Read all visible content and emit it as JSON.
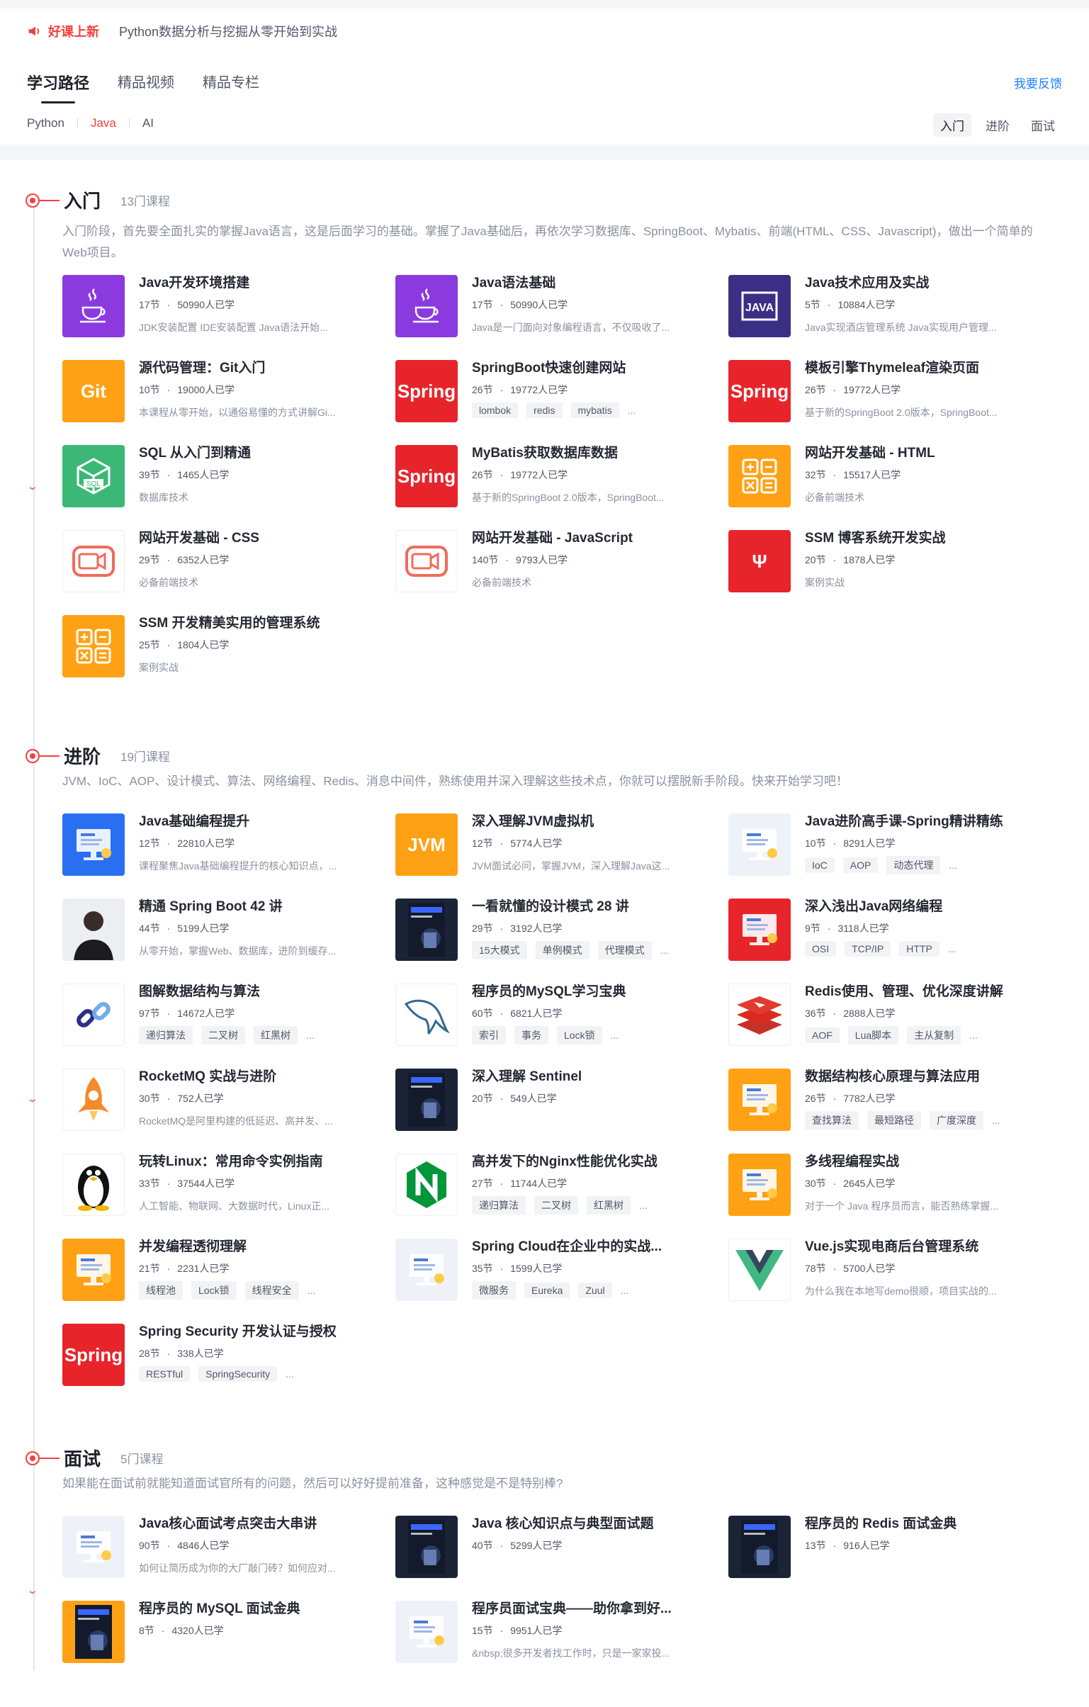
{
  "banner": {
    "tag": "好课上新",
    "title": "Python数据分析与挖掘从零开始到实战"
  },
  "nav": {
    "tabs": [
      "学习路径",
      "精品视频",
      "精品专栏"
    ],
    "feedback": "我要反馈",
    "subtabs": [
      "Python",
      "Java",
      "AI"
    ],
    "levels": [
      "入门",
      "进阶",
      "面试"
    ]
  },
  "sections": [
    {
      "title": "入门",
      "count": "13门课程",
      "desc": "入门阶段，首先要全面扎实的掌握Java语言，这是后面学习的基础。掌握了Java基础后，再依次学习数据库、SpringBoot、Mybatis、前端(HTML、CSS、Javascript)，做出一个简单的Web项目。",
      "courses": [
        {
          "title": "Java开发环境搭建",
          "lessons": "17节",
          "learners": "50990人已学",
          "desc": "JDK安装配置 IDE安装配置 Java语法开始...",
          "tags": [],
          "thumb": "java-cup",
          "bg": "t-purple"
        },
        {
          "title": "Java语法基础",
          "lessons": "17节",
          "learners": "50990人已学",
          "desc": "Java是一门面向对象编程语言，不仅吸收了...",
          "tags": [],
          "thumb": "java-cup",
          "bg": "t-purple"
        },
        {
          "title": "Java技术应用及实战",
          "lessons": "5节",
          "learners": "10884人已学",
          "desc": "Java实现酒店管理系统 Java实现用户管理...",
          "tags": [],
          "thumb": "java-logo",
          "bg": "t-navy"
        },
        {
          "title": "源代码管理：Git入门",
          "lessons": "10节",
          "learners": "19000人已学",
          "desc": "本课程从零开始，以通俗易懂的方式讲解Gi...",
          "tags": [],
          "thumb": "Git",
          "bg": "t-orange"
        },
        {
          "title": "SpringBoot快速创建网站",
          "lessons": "26节",
          "learners": "19772人已学",
          "desc": "",
          "tags": [
            "lombok",
            "redis",
            "mybatis"
          ],
          "thumb": "Spring",
          "bg": "t-red"
        },
        {
          "title": "模板引擎Thymeleaf渲染页面",
          "lessons": "26节",
          "learners": "19772人已学",
          "desc": "基于新的SpringBoot 2.0版本，SpringBoot...",
          "tags": [],
          "thumb": "Spring",
          "bg": "t-red"
        },
        {
          "title": "SQL 从入门到精通",
          "lessons": "39节",
          "learners": "1465人已学",
          "desc": "数据库技术",
          "tags": [],
          "thumb": "sql-box",
          "bg": "t-green"
        },
        {
          "title": "MyBatis获取数据库数据",
          "lessons": "26节",
          "learners": "19772人已学",
          "desc": "基于新的SpringBoot 2.0版本，SpringBoot...",
          "tags": [],
          "thumb": "Spring",
          "bg": "t-red"
        },
        {
          "title": "网站开发基础 - HTML",
          "lessons": "32节",
          "learners": "15517人已学",
          "desc": "必备前端技术",
          "tags": [],
          "thumb": "calc",
          "bg": "t-orange"
        },
        {
          "title": "网站开发基础 - CSS",
          "lessons": "29节",
          "learners": "6352人已学",
          "desc": "必备前端技术",
          "tags": [],
          "thumb": "video",
          "bg": "t-white"
        },
        {
          "title": "网站开发基础 - JavaScript",
          "lessons": "140节",
          "learners": "9793人已学",
          "desc": "必备前端技术",
          "tags": [],
          "thumb": "video",
          "bg": "t-white"
        },
        {
          "title": "SSM 博客系统开发实战",
          "lessons": "20节",
          "learners": "1878人已学",
          "desc": "案例实战",
          "tags": [],
          "thumb": "Ψ",
          "bg": "t-red"
        },
        {
          "title": "SSM 开发精美实用的管理系统",
          "lessons": "25节",
          "learners": "1804人已学",
          "desc": "案例实战",
          "tags": [],
          "thumb": "calc",
          "bg": "t-orange"
        }
      ]
    },
    {
      "title": "进阶",
      "count": "19门课程",
      "desc": "JVM、IoC、AOP、设计模式、算法、网络编程、Redis、消息中间件，熟练使用并深入理解这些技术点，你就可以摆脱新手阶段。快来开始学习吧！",
      "courses": [
        {
          "title": "Java基础编程提升",
          "lessons": "12节",
          "learners": "22810人已学",
          "desc": "课程聚焦Java基础编程提升的核心知识点，...",
          "tags": [],
          "thumb": "screen",
          "bg": "t-blue"
        },
        {
          "title": "深入理解JVM虚拟机",
          "lessons": "12节",
          "learners": "5774人已学",
          "desc": "JVM面试必问，掌握JVM，深入理解Java这...",
          "tags": [],
          "thumb": "JVM",
          "bg": "t-orange"
        },
        {
          "title": "Java进阶高手课-Spring精讲精练",
          "lessons": "10节",
          "learners": "8291人已学",
          "desc": "",
          "tags": [
            "IoC",
            "AOP",
            "动态代理"
          ],
          "thumb": "screen",
          "bg": "t-light"
        },
        {
          "title": "精通 Spring Boot 42 讲",
          "lessons": "44节",
          "learners": "5199人已学",
          "desc": "从零开始，掌握Web、数据库，进阶到缓存...",
          "tags": [],
          "thumb": "person",
          "bg": "t-white"
        },
        {
          "title": "一看就懂的设计模式 28 讲",
          "lessons": "29节",
          "learners": "3192人已学",
          "desc": "",
          "tags": [
            "15大模式",
            "单例模式",
            "代理模式"
          ],
          "thumb": "book",
          "bg": "t-dark"
        },
        {
          "title": "深入浅出Java网络编程",
          "lessons": "9节",
          "learners": "3118人已学",
          "desc": "",
          "tags": [
            "OSI",
            "TCP/IP",
            "HTTP"
          ],
          "thumb": "screen",
          "bg": "t-red"
        },
        {
          "title": "图解数据结构与算法",
          "lessons": "97节",
          "learners": "14672人已学",
          "desc": "",
          "tags": [
            "递归算法",
            "二叉树",
            "红黑树"
          ],
          "thumb": "link",
          "bg": "t-white"
        },
        {
          "title": "程序员的MySQL学习宝典",
          "lessons": "60节",
          "learners": "6821人已学",
          "desc": "",
          "tags": [
            "索引",
            "事务",
            "Lock锁"
          ],
          "thumb": "dolphin",
          "bg": "t-white"
        },
        {
          "title": "Redis使用、管理、优化深度讲解",
          "lessons": "36节",
          "learners": "2888人已学",
          "desc": "",
          "tags": [
            "AOF",
            "Lua脚本",
            "主从复制"
          ],
          "thumb": "redis",
          "bg": "t-white"
        },
        {
          "title": "RocketMQ 实战与进阶",
          "lessons": "30节",
          "learners": "752人已学",
          "desc": "RocketMQ是阿里构建的低延迟、高并发、...",
          "tags": [],
          "thumb": "rocket",
          "bg": "t-white"
        },
        {
          "title": "深入理解 Sentinel",
          "lessons": "20节",
          "learners": "549人已学",
          "desc": "",
          "tags": [],
          "thumb": "book",
          "bg": "t-dark"
        },
        {
          "title": "数据结构核心原理与算法应用",
          "lessons": "26节",
          "learners": "7782人已学",
          "desc": "",
          "tags": [
            "查找算法",
            "最短路径",
            "广度深度"
          ],
          "thumb": "screen",
          "bg": "t-orange"
        },
        {
          "title": "玩转Linux：常用命令实例指南",
          "lessons": "33节",
          "learners": "37544人已学",
          "desc": "人工智能、物联网、大数据时代，Linux正...",
          "tags": [],
          "thumb": "penguin",
          "bg": "t-white"
        },
        {
          "title": "高并发下的Nginx性能优化实战",
          "lessons": "27节",
          "learners": "11744人已学",
          "desc": "",
          "tags": [
            "递归算法",
            "二叉树",
            "红黑树"
          ],
          "thumb": "N",
          "bg": "t-white"
        },
        {
          "title": "多线程编程实战",
          "lessons": "30节",
          "learners": "2645人已学",
          "desc": "对于一个 Java 程序员而言，能否熟练掌握...",
          "tags": [],
          "thumb": "screen",
          "bg": "t-orange"
        },
        {
          "title": "并发编程透彻理解",
          "lessons": "21节",
          "learners": "2231人已学",
          "desc": "",
          "tags": [
            "线程池",
            "Lock锁",
            "线程安全"
          ],
          "thumb": "screen",
          "bg": "t-orange"
        },
        {
          "title": "Spring Cloud在企业中的实战...",
          "lessons": "35节",
          "learners": "1599人已学",
          "desc": "",
          "tags": [
            "微服务",
            "Eureka",
            "Zuul"
          ],
          "thumb": "screen",
          "bg": "t-light"
        },
        {
          "title": "Vue.js实现电商后台管理系统",
          "lessons": "78节",
          "learners": "5700人已学",
          "desc": "为什么我在本地写demo很顺，项目实战的...",
          "tags": [],
          "thumb": "vue",
          "bg": "t-white"
        },
        {
          "title": "Spring Security 开发认证与授权",
          "lessons": "28节",
          "learners": "338人已学",
          "desc": "",
          "tags": [
            "RESTful",
            "SpringSecurity"
          ],
          "thumb": "Spring",
          "bg": "t-red"
        }
      ]
    },
    {
      "title": "面试",
      "count": "5门课程",
      "desc": "如果能在面试前就能知道面试官所有的问题，然后可以好好提前准备，这种感觉是不是特别棒?",
      "courses": [
        {
          "title": "Java核心面试考点突击大串讲",
          "lessons": "90节",
          "learners": "4846人已学",
          "desc": "如何让简历成为你的大厂敲门砖？如何应对...",
          "tags": [],
          "thumb": "screen",
          "bg": "t-light"
        },
        {
          "title": "Java 核心知识点与典型面试题",
          "lessons": "40节",
          "learners": "5299人已学",
          "desc": "",
          "tags": [],
          "thumb": "book",
          "bg": "t-dark"
        },
        {
          "title": "程序员的 Redis 面试金典",
          "lessons": "13节",
          "learners": "916人已学",
          "desc": "",
          "tags": [],
          "thumb": "book",
          "bg": "t-dark"
        },
        {
          "title": "程序员的 MySQL 面试金典",
          "lessons": "8节",
          "learners": "4320人已学",
          "desc": "",
          "tags": [],
          "thumb": "book",
          "bg": "t-orange"
        },
        {
          "title": "程序员面试宝典——助你拿到好...",
          "lessons": "15节",
          "learners": "9951人已学",
          "desc": "&nbsp;很多开发者找工作时，只是一家家投...",
          "tags": [],
          "thumb": "screen",
          "bg": "t-light"
        }
      ]
    }
  ]
}
